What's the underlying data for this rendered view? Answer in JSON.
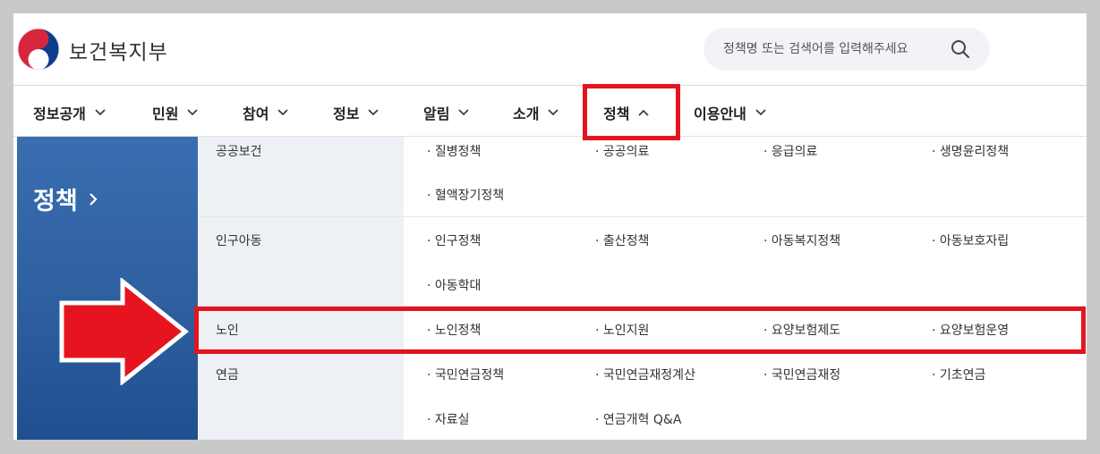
{
  "header": {
    "site_name": "보건복지부",
    "search_placeholder": "정책명 또는 검색어를 입력해주세요",
    "search_icon": "search-icon",
    "logo_icon": "taegeuk-logo-icon"
  },
  "nav": {
    "items": [
      {
        "label": "정보공개",
        "state": "collapsed"
      },
      {
        "label": "민원",
        "state": "collapsed"
      },
      {
        "label": "참여",
        "state": "collapsed"
      },
      {
        "label": "정보",
        "state": "collapsed"
      },
      {
        "label": "알림",
        "state": "collapsed"
      },
      {
        "label": "소개",
        "state": "collapsed"
      },
      {
        "label": "정책",
        "state": "expanded"
      },
      {
        "label": "이용안내",
        "state": "collapsed"
      }
    ]
  },
  "menu": {
    "title": "정책",
    "categories": [
      {
        "label": "공공보건",
        "items": [
          "질병정책",
          "공공의료",
          "응급의료",
          "생명윤리정책",
          "혈액장기정책"
        ]
      },
      {
        "label": "인구아동",
        "items": [
          "인구정책",
          "출산정책",
          "아동복지정책",
          "아동보호자립",
          "아동학대"
        ]
      },
      {
        "label": "노인",
        "items": [
          "노인정책",
          "노인지원",
          "요양보험제도",
          "요양보험운영"
        ]
      },
      {
        "label": "연금",
        "items": [
          "국민연금정책",
          "국민연금재정계산",
          "국민연금재정",
          "기초연금",
          "자료실",
          "연금개혁 Q&A"
        ]
      }
    ]
  },
  "colors": {
    "accent_red": "#e5141f",
    "panel_blue": "#2e5f9f",
    "category_bg": "#edf0f5"
  }
}
